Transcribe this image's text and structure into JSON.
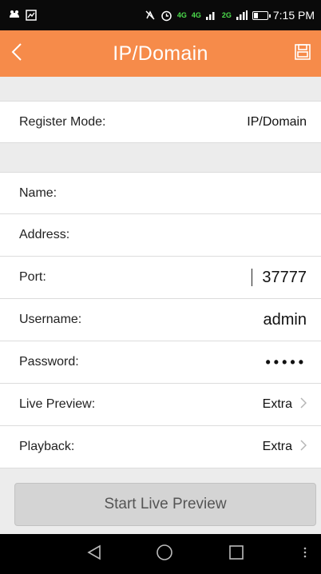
{
  "status_bar": {
    "time": "7:15 PM",
    "net_4g_a": "4G",
    "net_4g_b": "4G",
    "net_2g": "2G",
    "icons": [
      "notification-icon",
      "image-icon",
      "mute-icon",
      "alarm-icon",
      "signal-icon",
      "battery-icon"
    ]
  },
  "header": {
    "title": "IP/Domain",
    "back_icon": "chevron-left-icon",
    "save_icon": "save-icon",
    "color": "#f68b4a"
  },
  "form": {
    "register_mode": {
      "label": "Register Mode:",
      "value": "IP/Domain"
    },
    "name": {
      "label": "Name:",
      "value": ""
    },
    "address": {
      "label": "Address:",
      "value": ""
    },
    "port": {
      "label": "Port:",
      "value": "37777"
    },
    "username": {
      "label": "Username:",
      "value": "admin"
    },
    "password": {
      "label": "Password:",
      "value": "•••••"
    },
    "live_preview": {
      "label": "Live Preview:",
      "value": "Extra"
    },
    "playback": {
      "label": "Playback:",
      "value": "Extra"
    }
  },
  "actions": {
    "start_live_preview": "Start Live Preview"
  },
  "navbar": {
    "icons": [
      "back-triangle-icon",
      "home-circle-icon",
      "recents-square-icon",
      "overflow-menu-icon"
    ]
  }
}
